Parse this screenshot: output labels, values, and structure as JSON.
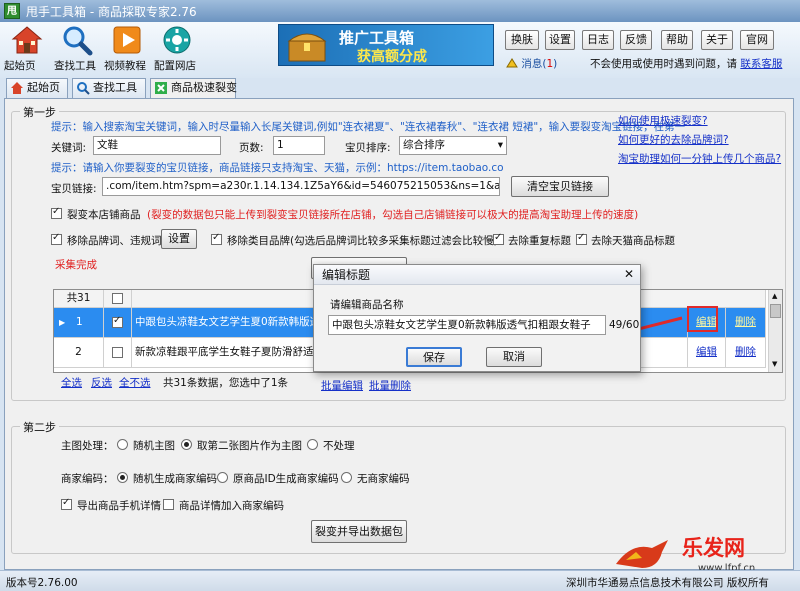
{
  "window": {
    "title": "甩手工具箱 - 商品採取专家2.76",
    "logo_text": "甩"
  },
  "toolbar": {
    "buttons": [
      {
        "label": "起始页",
        "icon": "home-icon"
      },
      {
        "label": "查找工具",
        "icon": "search-icon"
      },
      {
        "label": "视频教程",
        "icon": "video-icon"
      },
      {
        "label": "配置网店",
        "icon": "settings-icon"
      }
    ]
  },
  "banner": {
    "line1": "推广工具箱",
    "line2": "获高额分成"
  },
  "top_buttons": [
    "换肤",
    "设置",
    "日志",
    "反馈",
    "帮助",
    "关于",
    "官网"
  ],
  "messages": {
    "label": "消息(",
    "count": "1",
    "close": ")"
  },
  "help": {
    "text": "不会使用或使用时遇到问题，请",
    "link": "联系客服"
  },
  "tabs": [
    {
      "label": "起始页",
      "icon": "home-icon"
    },
    {
      "label": "查找工具",
      "icon": "search-icon"
    },
    {
      "label": "商品极速裂变",
      "icon": "split-icon"
    }
  ],
  "step1": {
    "title": "第一步",
    "hint1": "提示：输入搜索淘宝关键词，输入时尽量输入长尾关键词,例如\"连衣裙夏\"、\"连衣裙春秋\"、\"连衣裙 短裙\"，输入要裂变淘宝链接，在第一",
    "keyword_label": "关键词:",
    "keyword_value": "文鞋",
    "pages_label": "页数:",
    "pages_value": "1",
    "sort_label": "宝贝排序:",
    "sort_value": "综合排序",
    "hint2": "提示：请输入你要裂变的宝贝链接，商品链接只支持淘宝、天猫，示例：https://item.taobao.co",
    "link_label": "宝贝链接:",
    "link_value": ".com/item.htm?spm=a230r.1.14.134.1Z5aY6&id=546075215053&ns=1&abbucket=19#detail",
    "clear_button": "清空宝贝链接",
    "links": [
      "如何使用极速裂变?",
      "如何更好的去除品牌词?",
      "淘宝助理如何一分钟上传几个商品?"
    ],
    "split_shop_label": "裂变本店铺商品",
    "split_shop_note": "(裂变的数据包只能上传到裂变宝贝链接所在店铺，勾选自己店铺链接可以极大的提高淘宝助理上传的速度)",
    "remove_brand_label": "移除品牌词、违规词",
    "settings_button": "设置",
    "remove_category_label": "移除类目品牌(勾选后品牌词比较多采集标题过滤会比较慢)",
    "dedupe_label": "去除重复标题",
    "remove_tmall_label": "去除天猫商品标题",
    "status": "采集完成"
  },
  "grid": {
    "header_count": "共31",
    "rows": [
      {
        "index": "1",
        "checked": true,
        "title": "中跟包头凉鞋女文艺学生夏0新款韩版透气扣",
        "edit": "编辑",
        "delete": "删除"
      },
      {
        "index": "2",
        "checked": false,
        "title": "新款凉鞋跟平底学生女鞋子夏防滑舒适坡跟",
        "edit": "编辑",
        "delete": "删除"
      }
    ],
    "select_all": "全选",
    "invert": "反选",
    "select_none": "全不选",
    "summary": "共31条数据，您选中了1条",
    "batch_edit": "批量编辑",
    "batch_delete": "批量删除"
  },
  "dialog": {
    "title": "编辑标题",
    "prompt": "请编辑商品名称",
    "value": "中跟包头凉鞋女文艺学生夏0新款韩版透气扣粗跟女鞋子",
    "counter": "49/60",
    "save": "保存",
    "cancel": "取消"
  },
  "step2": {
    "title": "第二步",
    "main_image_label": "主图处理：",
    "main_image_options": [
      "随机主图",
      "取第二张图片作为主图",
      "不处理"
    ],
    "code_label": "商家编码：",
    "code_options": [
      "随机生成商家编码",
      "原商品ID生成商家编码",
      "无商家编码"
    ],
    "export_mobile_label": "导出商品手机详情",
    "detail_code_label": "商品详情加入商家编码",
    "export_button": "裂变并导出数据包"
  },
  "status": {
    "version": "版本号2.76.00",
    "company": "深圳市华通易点信息技术有限公司 版权所有"
  },
  "watermark": {
    "text": "乐发网",
    "url": "www.lfpf.cn"
  },
  "colors": {
    "accent": "#1a6fc0",
    "highlight": "#2b8cf0",
    "red": "#e02020",
    "annotation": "#e02a2a"
  }
}
